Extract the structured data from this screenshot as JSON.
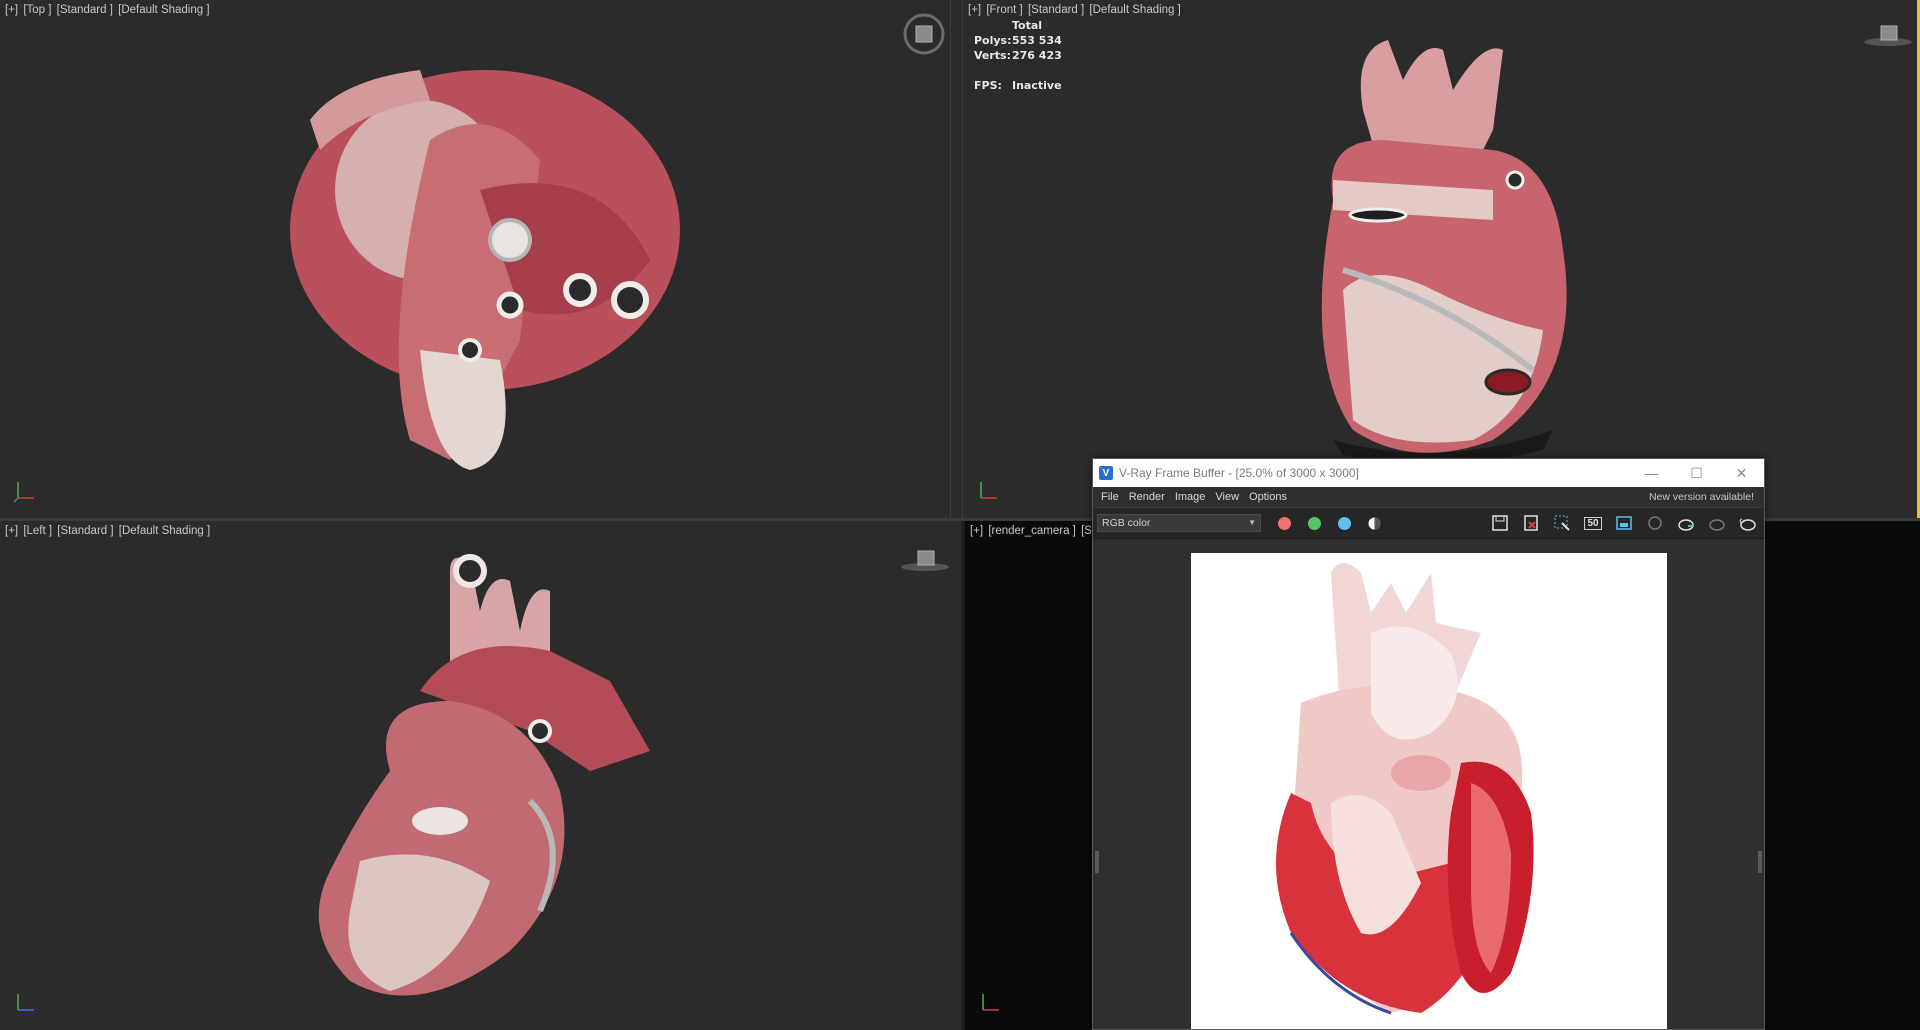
{
  "viewports": {
    "top": {
      "labels": [
        "[+]",
        "[Top ]",
        "[Standard ]",
        "[Default Shading ]"
      ]
    },
    "front": {
      "labels": [
        "[+]",
        "[Front ]",
        "[Standard ]",
        "[Default Shading ]"
      ]
    },
    "left": {
      "labels": [
        "[+]",
        "[Left ]",
        "[Standard ]",
        "[Default Shading ]"
      ]
    },
    "camera": {
      "labels": [
        "[+]",
        "[render_camera ]",
        "[St"
      ]
    }
  },
  "stats": {
    "total_label": "Total",
    "polys_label": "Polys:",
    "polys_value": "553 534",
    "verts_label": "Verts:",
    "verts_value": "276 423",
    "fps_label": "FPS:",
    "fps_value": "Inactive"
  },
  "vfb": {
    "title": "V-Ray Frame Buffer - [25.0% of 3000 x 3000]",
    "logo": "V",
    "menu": [
      "File",
      "Render",
      "Image",
      "View",
      "Options"
    ],
    "new_version": "New version available!",
    "channel": "RGB color",
    "zoom_label": "50",
    "colors": {
      "red": "#f07070",
      "green": "#55c46a",
      "blue": "#5bc0f0"
    }
  },
  "icons": [
    "viewcube-icon",
    "axis-tripod-icon",
    "save-icon",
    "clear-icon",
    "region-select-icon",
    "zoom-icon",
    "frame-icon",
    "render-teapot-icon",
    "minimize-icon",
    "maximize-icon",
    "close-icon"
  ]
}
